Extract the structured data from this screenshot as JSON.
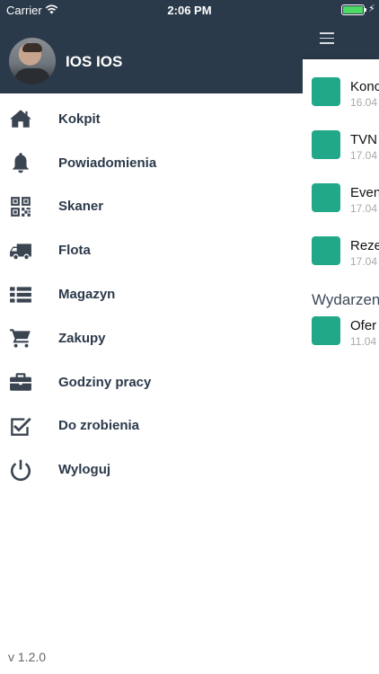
{
  "status_bar": {
    "carrier": "Carrier",
    "time": "2:06 PM"
  },
  "user": {
    "name": "IOS IOS"
  },
  "menu": {
    "items": [
      {
        "label": "Kokpit",
        "icon": "home-icon"
      },
      {
        "label": "Powiadomienia",
        "icon": "bell-icon"
      },
      {
        "label": "Skaner",
        "icon": "qr-code-icon"
      },
      {
        "label": "Flota",
        "icon": "truck-icon"
      },
      {
        "label": "Magazyn",
        "icon": "list-icon"
      },
      {
        "label": "Zakupy",
        "icon": "cart-icon"
      },
      {
        "label": "Godziny pracy",
        "icon": "briefcase-icon"
      },
      {
        "label": "Do zrobienia",
        "icon": "checkbox-icon"
      },
      {
        "label": "Wyloguj",
        "icon": "power-icon"
      }
    ]
  },
  "version": "v 1.2.0",
  "background": {
    "items": [
      {
        "title": "Konc",
        "date": "16.04"
      },
      {
        "title": "TVN",
        "date": "17.04"
      },
      {
        "title": "Even",
        "date": "17.04"
      },
      {
        "title": "Reze",
        "date": "17.04"
      }
    ],
    "section_title": "Wydarzen",
    "section_items": [
      {
        "title": "Ofer",
        "date": "11.04"
      }
    ]
  },
  "colors": {
    "header": "#2b3a4a",
    "accent": "#20a888",
    "battery": "#4cd964"
  }
}
